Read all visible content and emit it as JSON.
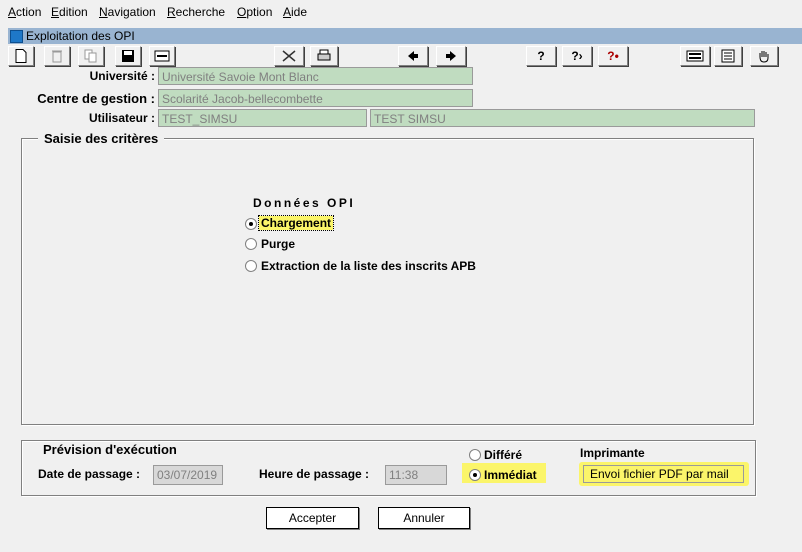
{
  "menu": {
    "items": [
      {
        "underline": "A",
        "rest": "ction"
      },
      {
        "underline": "E",
        "rest": "dition"
      },
      {
        "underline": "N",
        "rest": "avigation"
      },
      {
        "underline": "R",
        "rest": "echerche"
      },
      {
        "underline": "O",
        "rest": "ption"
      },
      {
        "underline": "A",
        "rest": "ide"
      }
    ]
  },
  "window": {
    "title": "Exploitation des OPI"
  },
  "toolbar": {
    "icons": [
      "new-document-icon",
      "delete-icon",
      "copy-icon",
      "save-icon",
      "minus-icon",
      "cut-icon",
      "print-icon",
      "arrow-left-icon",
      "arrow-right-icon",
      "help-icon",
      "help-context-icon",
      "help-alert-icon",
      "keyboard-icon",
      "list-icon",
      "hand-icon"
    ]
  },
  "header": {
    "universite_label": "Université :",
    "universite_value": "Université Savoie Mont Blanc",
    "centre_label": "Centre de gestion :",
    "centre_value": "Scolarité Jacob-bellecombette",
    "utilisateur_label": "Utilisateur :",
    "utilisateur_code": "TEST_SIMSU",
    "utilisateur_name": "TEST SIMSU"
  },
  "criteria": {
    "title": "Saisie des critères",
    "group_heading": "Données OPI",
    "options": [
      "Chargement",
      "Purge",
      "Extraction de la liste des inscrits APB"
    ],
    "selected": "Chargement"
  },
  "execution": {
    "title": "Prévision d'exécution",
    "date_label": "Date de passage :",
    "date_value": "03/07/2019",
    "heure_label": "Heure de passage :",
    "heure_value": "11:38",
    "mode_options": [
      "Différé",
      "Immédiat"
    ],
    "mode_selected": "Immédiat",
    "printer_label": "Imprimante",
    "printer_value": "Envoi fichier PDF par mail"
  },
  "buttons": {
    "accept": "Accepter",
    "cancel": "Annuler"
  },
  "colors": {
    "field_bg": "#c0dcc0",
    "title_bar": "#99b4d1",
    "highlight": "#fbf56a"
  }
}
